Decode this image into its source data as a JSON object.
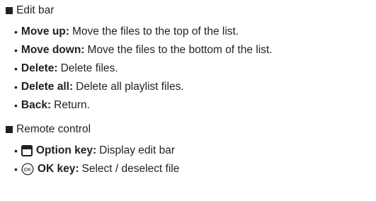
{
  "sections": [
    {
      "heading": "Edit bar",
      "items": [
        {
          "term": "Move up:",
          "desc": "Move the files to the top of the list."
        },
        {
          "term": "Move down:",
          "desc": "Move the files to the bottom of the list."
        },
        {
          "term": "Delete:",
          "desc": "Delete files."
        },
        {
          "term": "Delete all:",
          "desc": "Delete all playlist files."
        },
        {
          "term": "Back:",
          "desc": "Return."
        }
      ]
    },
    {
      "heading": "Remote control",
      "items": [
        {
          "icon": "option-key-icon",
          "term": "Option key:",
          "desc": "Display edit bar"
        },
        {
          "icon": "ok-key-icon",
          "icon_text": "OK",
          "term": "OK key:",
          "desc": "Select / deselect file"
        }
      ]
    }
  ],
  "bullet_char": "•"
}
